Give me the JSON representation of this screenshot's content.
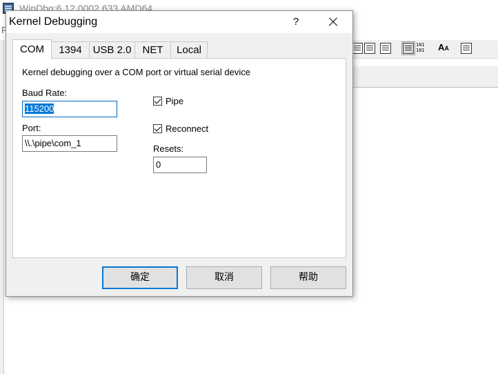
{
  "background_window": {
    "title": "WinDbg:6.12.0002.633 AMD64",
    "menu_first_letter": "F",
    "toolbar_icons": [
      "window-icon",
      "dialog-icon",
      "console-icon",
      "list-icon",
      "binary-101-icon",
      "font-icon",
      "properties-icon"
    ],
    "toolbar_binary_text": "101\n101",
    "toolbar_font_text": "A",
    "toolbar_font_small": "A"
  },
  "dialog": {
    "title": "Kernel Debugging",
    "help_glyph": "?",
    "tabs": [
      {
        "label": "COM",
        "active": true
      },
      {
        "label": "1394",
        "active": false
      },
      {
        "label": "USB 2.0",
        "active": false
      },
      {
        "label": "NET",
        "active": false
      },
      {
        "label": "Local",
        "active": false
      }
    ],
    "description": "Kernel debugging over a COM port or virtual serial device",
    "baud_rate": {
      "label": "Baud Rate:",
      "value": "115200"
    },
    "port": {
      "label": "Port:",
      "value": "\\\\.\\pipe\\com_1"
    },
    "pipe": {
      "label": "Pipe",
      "checked": true
    },
    "reconnect": {
      "label": "Reconnect",
      "checked": true
    },
    "resets": {
      "label": "Resets:",
      "value": "0"
    },
    "buttons": {
      "ok": "确定",
      "cancel": "取消",
      "help": "帮助"
    }
  }
}
